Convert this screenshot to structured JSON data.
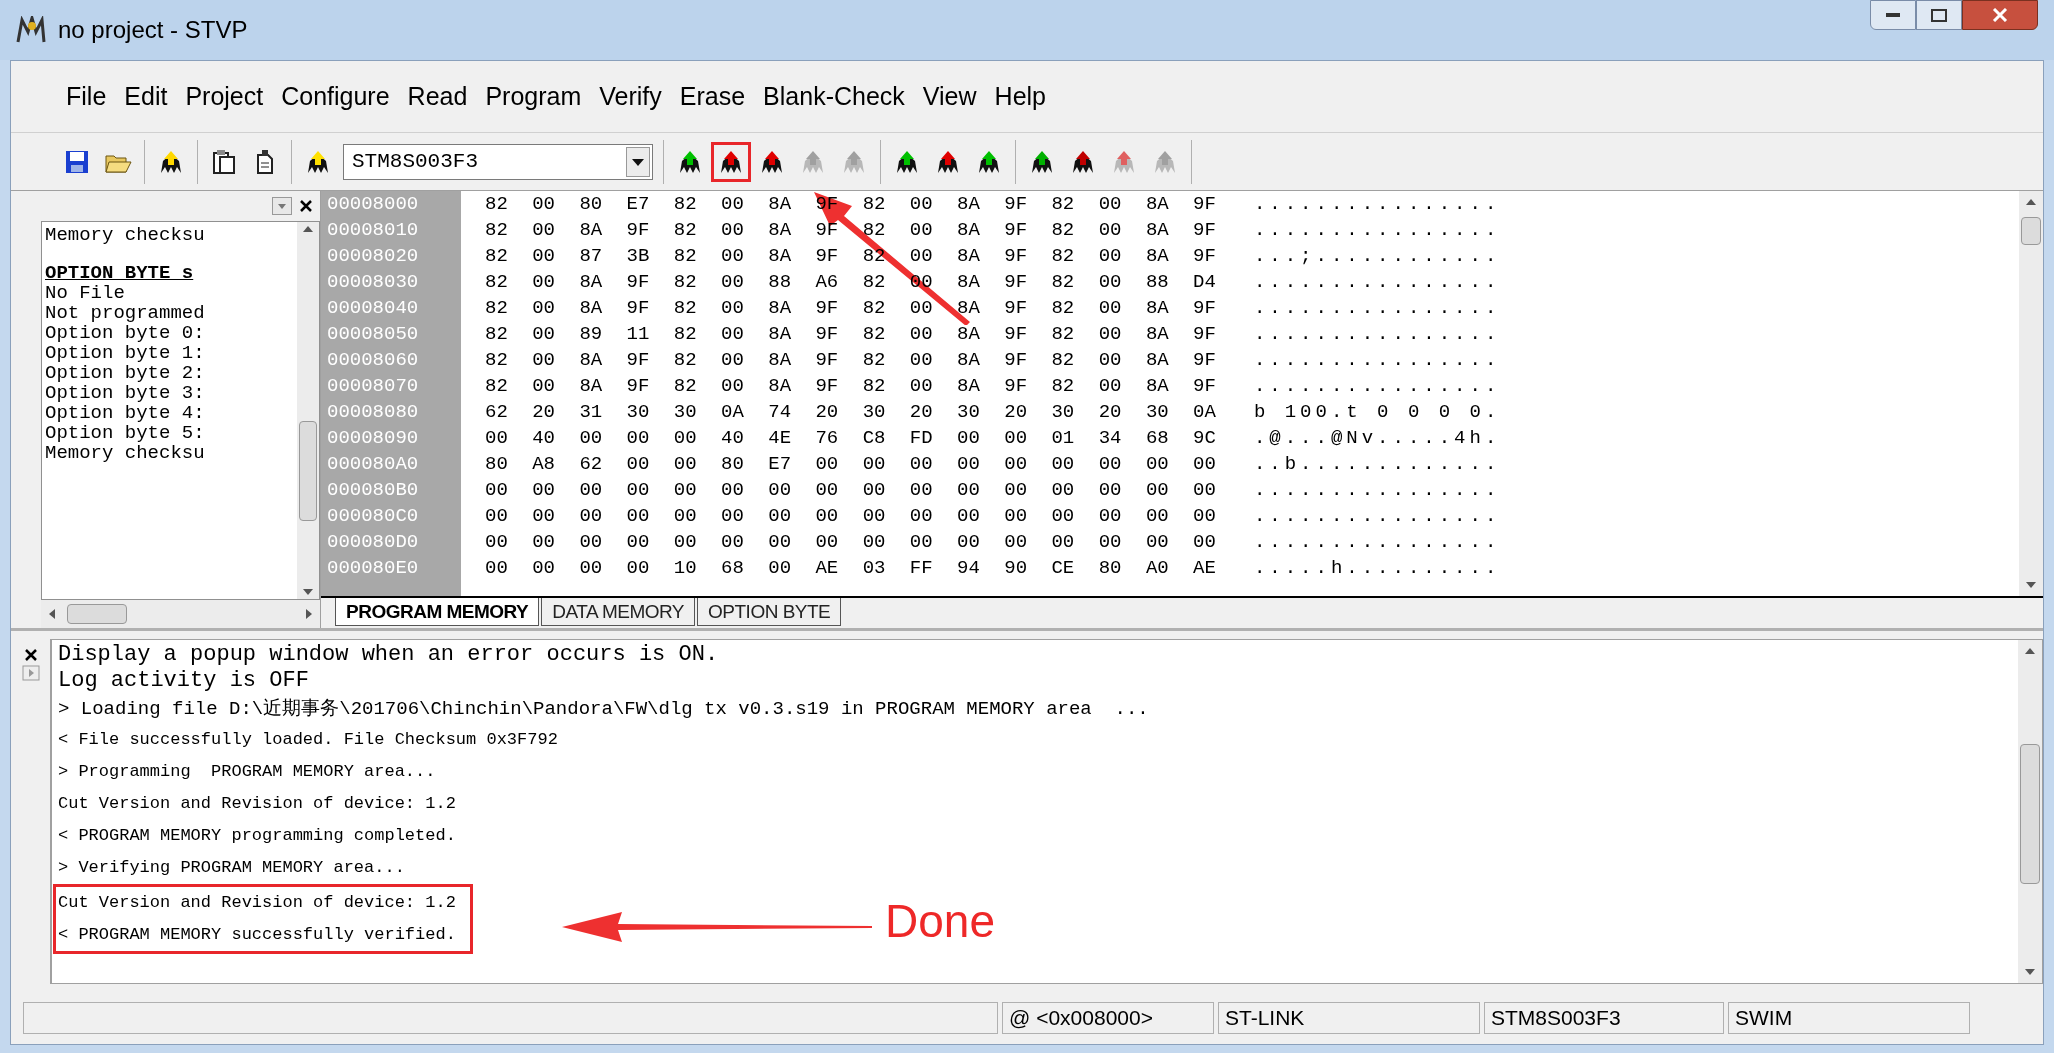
{
  "window": {
    "title": "no project - STVP"
  },
  "menu": [
    {
      "label": "File"
    },
    {
      "label": "Edit"
    },
    {
      "label": "Project"
    },
    {
      "label": "Configure"
    },
    {
      "label": "Read"
    },
    {
      "label": "Program"
    },
    {
      "label": "Verify"
    },
    {
      "label": "Erase"
    },
    {
      "label": "Blank-Check"
    },
    {
      "label": "View"
    },
    {
      "label": "Help"
    }
  ],
  "toolbar": {
    "groups": [
      {
        "items": [
          {
            "kind": "save"
          },
          {
            "kind": "open"
          }
        ]
      },
      {
        "items": [
          {
            "kind": "chip",
            "color": "#ffd800",
            "disabled": false,
            "annotated": false
          }
        ]
      },
      {
        "items": [
          {
            "kind": "copy"
          },
          {
            "kind": "paste"
          }
        ]
      },
      {
        "items": [
          {
            "kind": "chip",
            "color": "#ffe000",
            "disabled": false,
            "annotated": false
          },
          {
            "kind": "device",
            "value": "STM8S003F3"
          }
        ]
      },
      {
        "items": [
          {
            "kind": "chip",
            "color": "#00c000",
            "disabled": false,
            "annotated": false
          },
          {
            "kind": "chip",
            "color": "#e00000",
            "disabled": false,
            "annotated": true
          },
          {
            "kind": "chip",
            "color": "#e00000",
            "disabled": false,
            "annotated": false
          },
          {
            "kind": "chip",
            "color": "#a0a0a0",
            "disabled": true,
            "annotated": false
          },
          {
            "kind": "chip",
            "color": "#a0a0a0",
            "disabled": true,
            "annotated": false
          }
        ]
      },
      {
        "items": [
          {
            "kind": "chip",
            "color": "#00c000",
            "disabled": false,
            "annotated": false
          },
          {
            "kind": "chip",
            "color": "#e00000",
            "disabled": false,
            "annotated": false
          },
          {
            "kind": "chip",
            "color": "#00c000",
            "disabled": false,
            "annotated": false
          }
        ]
      },
      {
        "items": [
          {
            "kind": "chip",
            "color": "#00b000",
            "disabled": false,
            "annotated": false
          },
          {
            "kind": "chip",
            "color": "#c00000",
            "disabled": false,
            "annotated": false
          },
          {
            "kind": "chip",
            "color": "#e06060",
            "disabled": true,
            "annotated": false
          },
          {
            "kind": "chip",
            "color": "#a0a0a0",
            "disabled": true,
            "annotated": false
          }
        ]
      }
    ]
  },
  "info_panel": {
    "lines": [
      {
        "kind": "text",
        "text": "Memory checksu"
      },
      {
        "kind": "heading",
        "text": "OPTION BYTE s"
      },
      {
        "kind": "text",
        "text": "No File"
      },
      {
        "kind": "text",
        "text": "Not programmed"
      },
      {
        "kind": "text",
        "text": "Option byte 0:"
      },
      {
        "kind": "text",
        "text": "Option byte 1:"
      },
      {
        "kind": "text",
        "text": "Option byte 2:"
      },
      {
        "kind": "text",
        "text": "Option byte 3:"
      },
      {
        "kind": "text",
        "text": "Option byte 4:"
      },
      {
        "kind": "text",
        "text": "Option byte 5:"
      },
      {
        "kind": "text",
        "text": "Memory checksu"
      }
    ]
  },
  "memory": {
    "rows": [
      {
        "address": "00008000",
        "bytes": "82 00 80 E7 82 00 8A 9F 82 00 8A 9F 82 00 8A 9F",
        "ascii": "................"
      },
      {
        "address": "00008010",
        "bytes": "82 00 8A 9F 82 00 8A 9F 82 00 8A 9F 82 00 8A 9F",
        "ascii": "................"
      },
      {
        "address": "00008020",
        "bytes": "82 00 87 3B 82 00 8A 9F 82 00 8A 9F 82 00 8A 9F",
        "ascii": "...;............"
      },
      {
        "address": "00008030",
        "bytes": "82 00 8A 9F 82 00 88 A6 82 00 8A 9F 82 00 88 D4",
        "ascii": "................"
      },
      {
        "address": "00008040",
        "bytes": "82 00 8A 9F 82 00 8A 9F 82 00 8A 9F 82 00 8A 9F",
        "ascii": "................"
      },
      {
        "address": "00008050",
        "bytes": "82 00 89 11 82 00 8A 9F 82 00 8A 9F 82 00 8A 9F",
        "ascii": "................"
      },
      {
        "address": "00008060",
        "bytes": "82 00 8A 9F 82 00 8A 9F 82 00 8A 9F 82 00 8A 9F",
        "ascii": "................"
      },
      {
        "address": "00008070",
        "bytes": "82 00 8A 9F 82 00 8A 9F 82 00 8A 9F 82 00 8A 9F",
        "ascii": "................"
      },
      {
        "address": "00008080",
        "bytes": "62 20 31 30 30 0A 74 20 30 20 30 20 30 20 30 0A",
        "ascii": "b 100.t 0 0 0 0."
      },
      {
        "address": "00008090",
        "bytes": "00 40 00 00 00 40 4E 76 C8 FD 00 00 01 34 68 9C",
        "ascii": ".@...@Nv.....4h."
      },
      {
        "address": "000080A0",
        "bytes": "80 A8 62 00 00 80 E7 00 00 00 00 00 00 00 00 00",
        "ascii": "..b............."
      },
      {
        "address": "000080B0",
        "bytes": "00 00 00 00 00 00 00 00 00 00 00 00 00 00 00 00",
        "ascii": "................"
      },
      {
        "address": "000080C0",
        "bytes": "00 00 00 00 00 00 00 00 00 00 00 00 00 00 00 00",
        "ascii": "................"
      },
      {
        "address": "000080D0",
        "bytes": "00 00 00 00 00 00 00 00 00 00 00 00 00 00 00 00",
        "ascii": "................"
      },
      {
        "address": "000080E0",
        "bytes": "00 00 00 00 10 68 00 AE 03 FF 94 90 CE 80 A0 AE",
        "ascii": ".....h.........."
      }
    ],
    "tabs": [
      {
        "label": "PROGRAM MEMORY",
        "selected": true
      },
      {
        "label": "DATA MEMORY",
        "selected": false
      },
      {
        "label": "OPTION BYTE",
        "selected": false
      }
    ]
  },
  "log": {
    "lines": [
      {
        "kind": "large",
        "text": "Display a popup window when an error occurs is ON.",
        "boxed": false
      },
      {
        "kind": "large",
        "text": "Log activity is OFF",
        "boxed": false
      },
      {
        "kind": "medium",
        "text": "> Loading file D:\\近期事务\\201706\\Chinchin\\Pandora\\FW\\dlg tx v0.3.s19 in PROGRAM MEMORY area  ...",
        "boxed": false
      },
      {
        "kind": "small",
        "text": "< File successfully loaded. File Checksum 0x3F792",
        "boxed": false
      },
      {
        "kind": "small",
        "text": "> Programming  PROGRAM MEMORY area...",
        "boxed": false
      },
      {
        "kind": "small",
        "text": "Cut Version and Revision of device: 1.2",
        "boxed": false
      },
      {
        "kind": "small",
        "text": "< PROGRAM MEMORY programming completed.",
        "boxed": false
      },
      {
        "kind": "small",
        "text": "> Verifying PROGRAM MEMORY area...",
        "boxed": false
      },
      {
        "kind": "small",
        "text": "Cut Version and Revision of device: 1.2",
        "boxed": true
      },
      {
        "kind": "small",
        "text": "< PROGRAM MEMORY successfully verified.",
        "boxed": true
      }
    ],
    "annotation_label": "Done"
  },
  "status_bar": {
    "fields": [
      "@ <0x008000>",
      "ST-LINK",
      "STM8S003F3",
      "SWIM"
    ]
  }
}
